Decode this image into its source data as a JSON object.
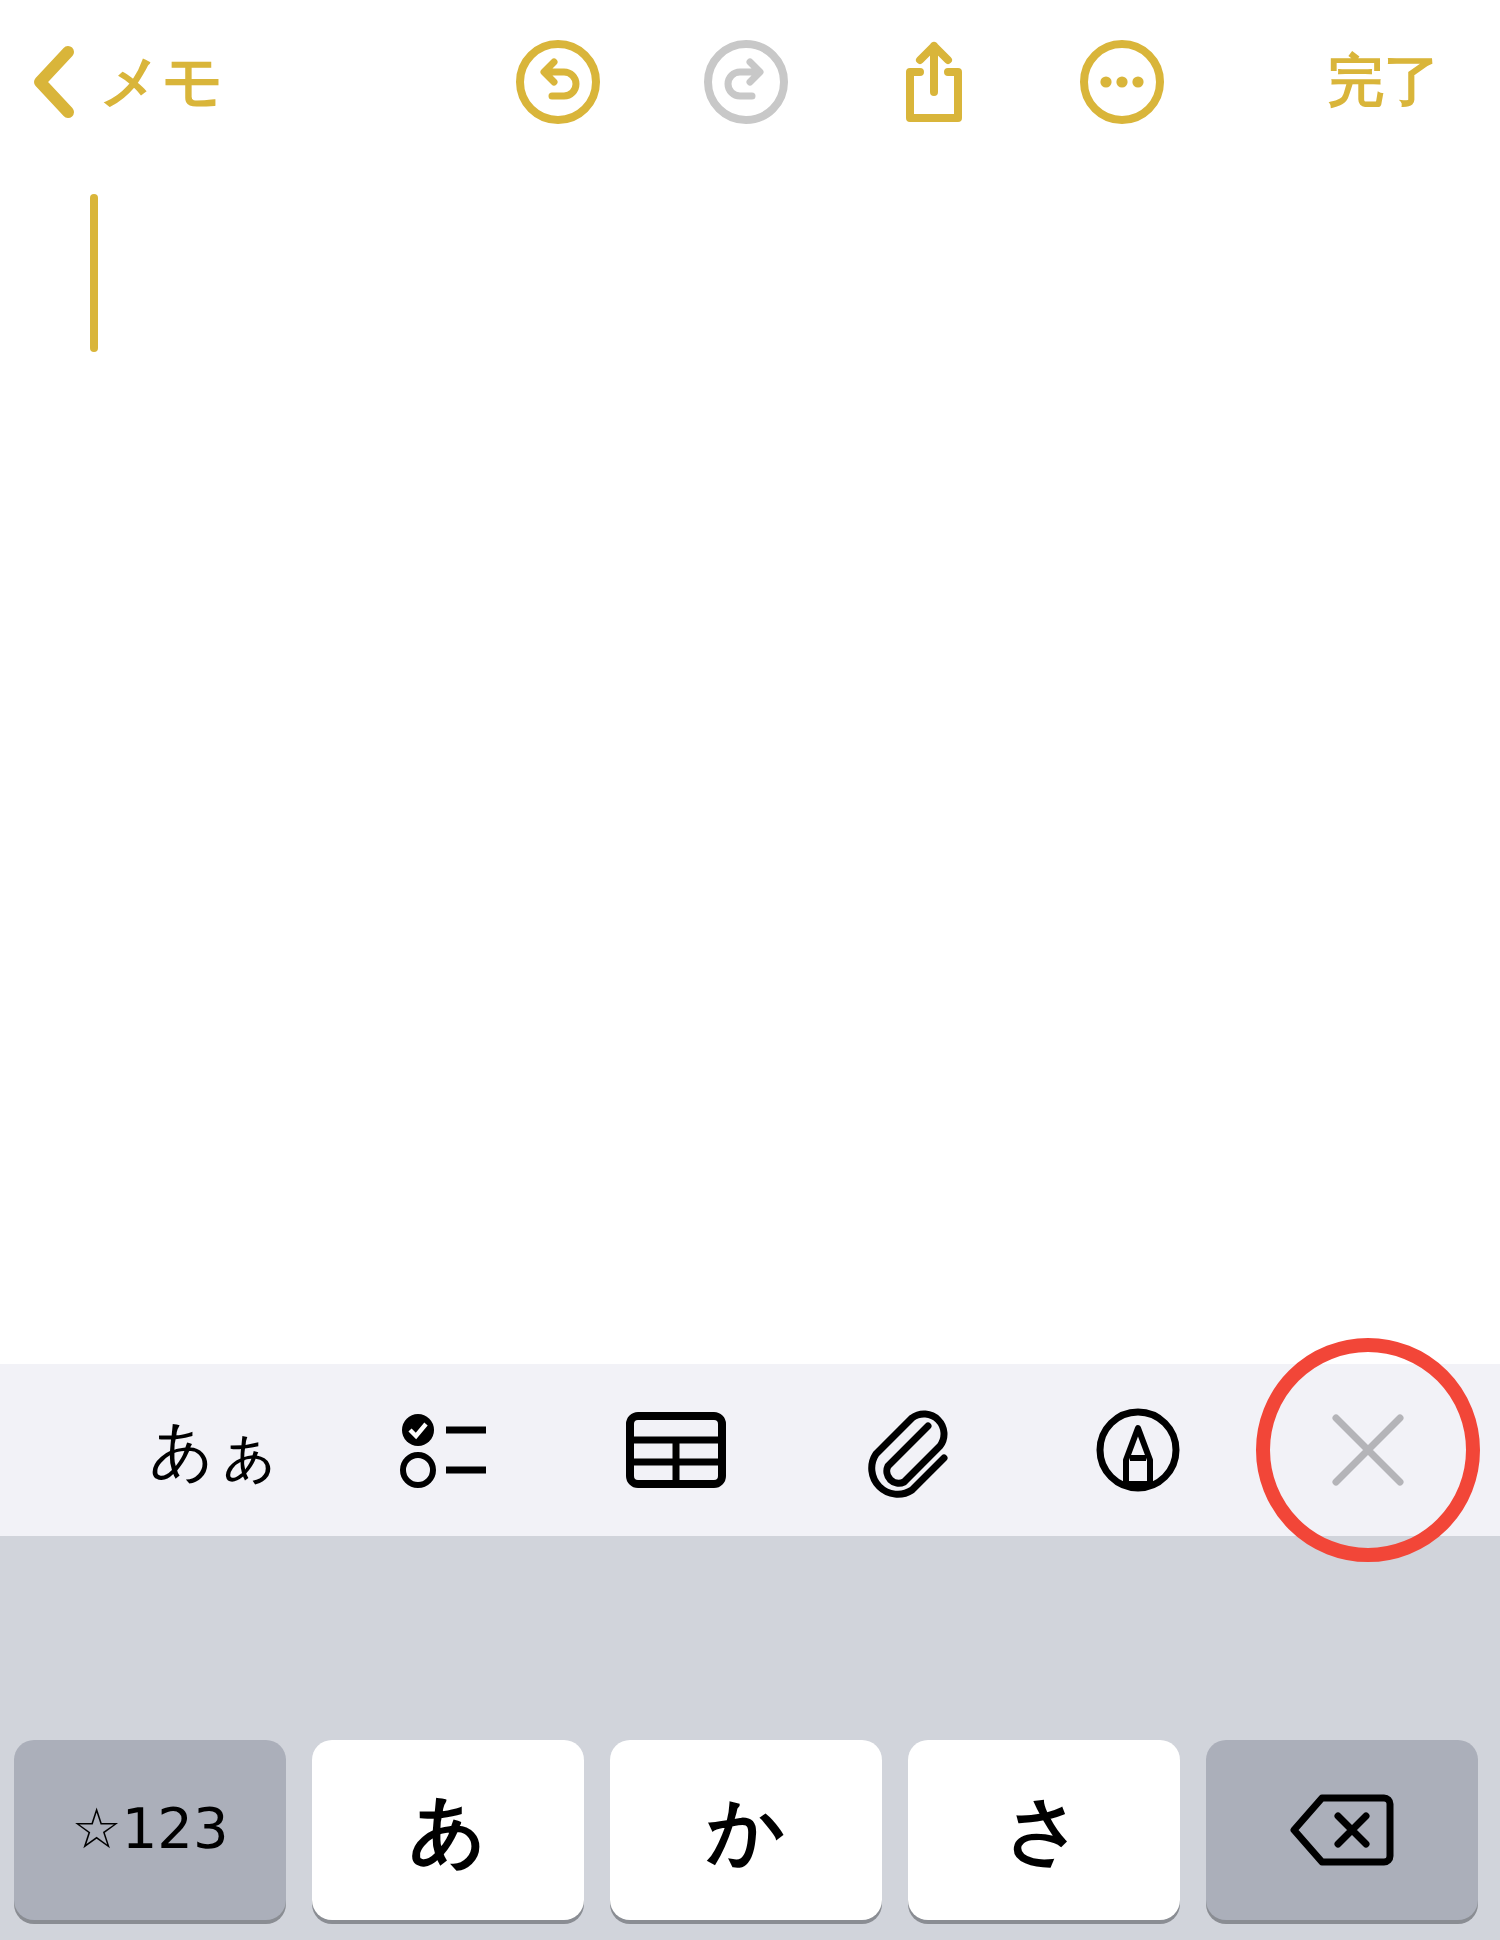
{
  "nav": {
    "back_label": "メモ",
    "buttons": [
      {
        "disabled": false
      },
      {
        "disabled": true
      },
      {
        "disabled": false
      },
      {
        "disabled": false
      }
    ],
    "done_label": "完了"
  },
  "format_bar": {
    "items": [
      {
        "kind": "text",
        "label": "あぁ",
        "highlighted": false
      },
      {
        "kind": "checklist",
        "highlighted": false
      },
      {
        "kind": "table",
        "highlighted": false
      },
      {
        "kind": "attach",
        "highlighted": false
      },
      {
        "kind": "markup",
        "highlighted": false
      },
      {
        "kind": "close",
        "highlighted": true
      }
    ]
  },
  "keyboard": {
    "keys": [
      {
        "kind": "function",
        "label": "☆123"
      },
      {
        "kind": "letter",
        "label": "あ"
      },
      {
        "kind": "letter",
        "label": "か"
      },
      {
        "kind": "letter",
        "label": "さ"
      },
      {
        "kind": "delete"
      }
    ]
  }
}
